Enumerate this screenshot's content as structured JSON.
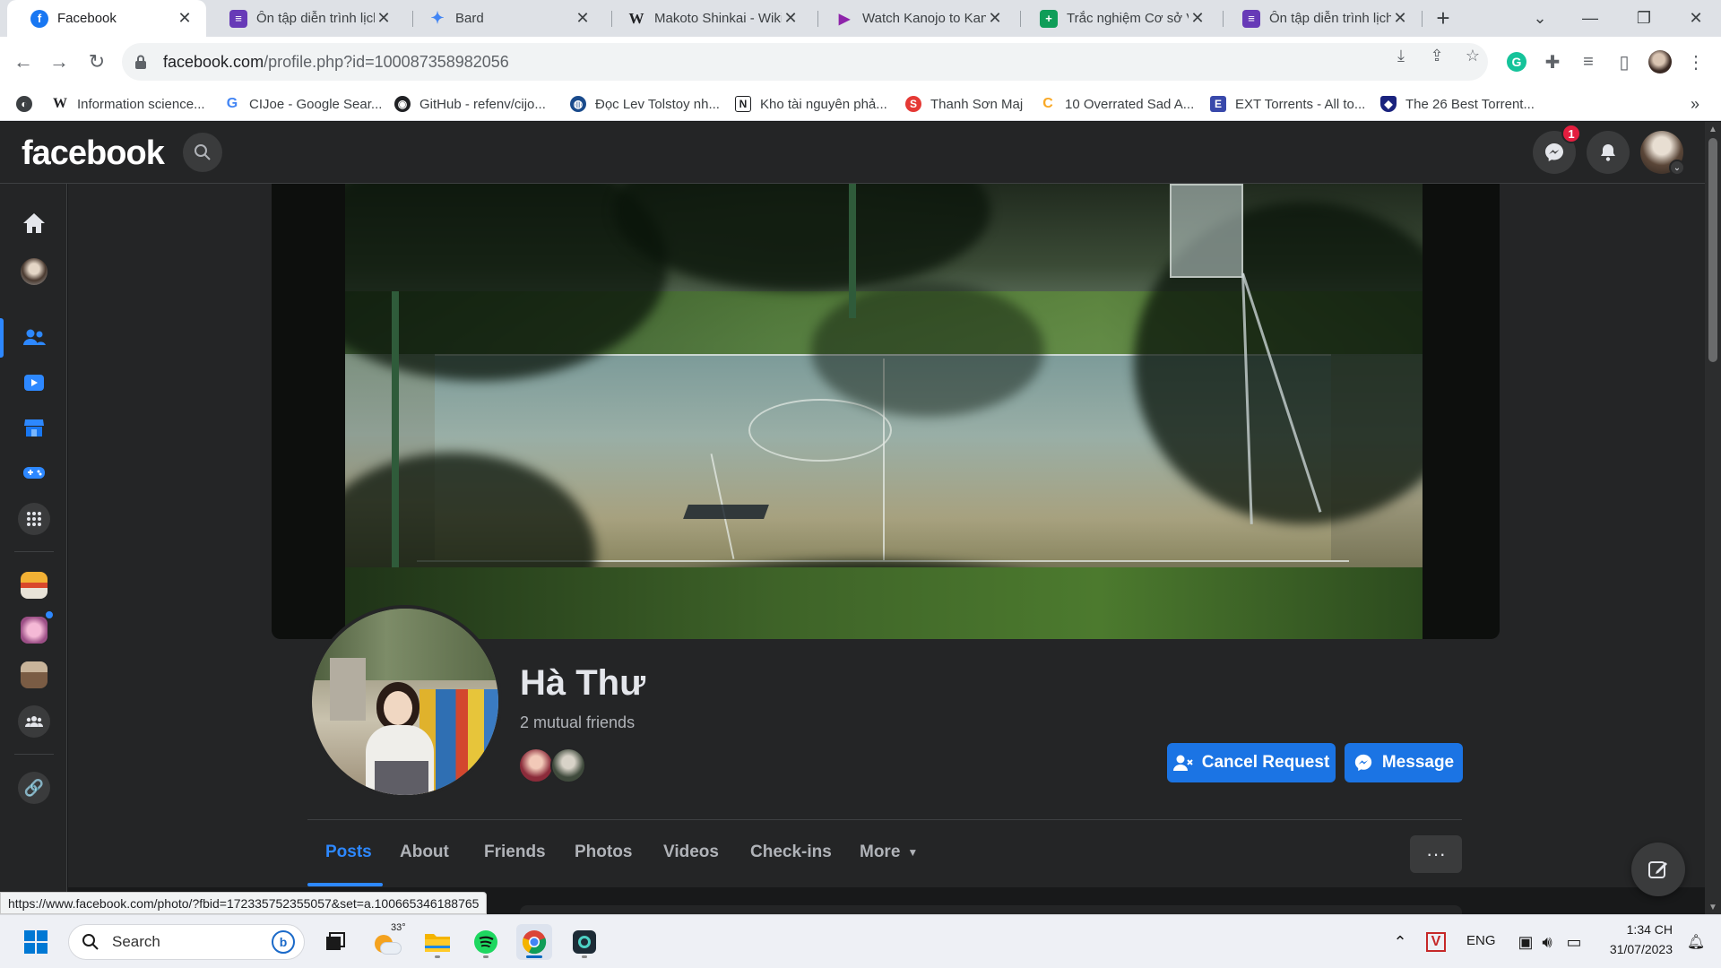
{
  "tabs": [
    {
      "title": "Facebook",
      "icon": "facebook-icon",
      "color": "#1877f2"
    },
    {
      "title": "Ôn tập diễn trình lịch",
      "icon": "forms-icon",
      "color": "#673ab7"
    },
    {
      "title": "Bard",
      "icon": "bard-icon",
      "color": "#4285f4"
    },
    {
      "title": "Makoto Shinkai - Wiki",
      "icon": "wikipedia-icon",
      "color": "#ffffff"
    },
    {
      "title": "Watch Kanojo to Kanojo",
      "icon": "play-icon",
      "color": "#8e24aa"
    },
    {
      "title": "Trắc nghiệm Cơ sở Vă",
      "icon": "sheets-icon",
      "color": "#0f9d58"
    },
    {
      "title": "Ôn tập diễn trình lịch",
      "icon": "forms-icon",
      "color": "#673ab7"
    }
  ],
  "address": {
    "host": "facebook.com",
    "path": "/profile.php?id=100087358982056"
  },
  "bookmarks": [
    {
      "label": "Information science...",
      "icon": "W"
    },
    {
      "label": "CIJoe - Google Sear...",
      "icon": "G"
    },
    {
      "label": "GitHub - refenv/cijo...",
      "icon": "github"
    },
    {
      "label": "Đọc Lev Tolstoy nh...",
      "icon": "globe"
    },
    {
      "label": "Kho tài nguyên phả...",
      "icon": "N"
    },
    {
      "label": "Thanh Sơn Maj",
      "icon": "S"
    },
    {
      "label": "10 Overrated Sad A...",
      "icon": "C"
    },
    {
      "label": "EXT Torrents - All to...",
      "icon": "E"
    },
    {
      "label": "The 26 Best Torrent...",
      "icon": "shield"
    }
  ],
  "facebook": {
    "logo": "facebook",
    "messenger_badge": "1"
  },
  "profile": {
    "name": "Hà Thư",
    "mutual_friends": "2 mutual friends",
    "cancel_request": "Cancel Request",
    "message": "Message",
    "tabs": [
      "Posts",
      "About",
      "Friends",
      "Photos",
      "Videos",
      "Check-ins",
      "More"
    ],
    "active_tab": "Posts",
    "more_options": "···"
  },
  "status_url": "https://www.facebook.com/photo/?fbid=172335752355057&set=a.100665346188765",
  "taskbar": {
    "search_placeholder": "Search",
    "weather_temp": "33°",
    "language": "ENG",
    "time": "1:34 CH",
    "date": "31/07/2023"
  },
  "colors": {
    "fb_blue": "#1b74e4",
    "fb_dark": "#242526",
    "fb_text": "#e4e6eb",
    "fb_secondary": "#b0b3b8",
    "badge_red": "#e41e3f"
  }
}
